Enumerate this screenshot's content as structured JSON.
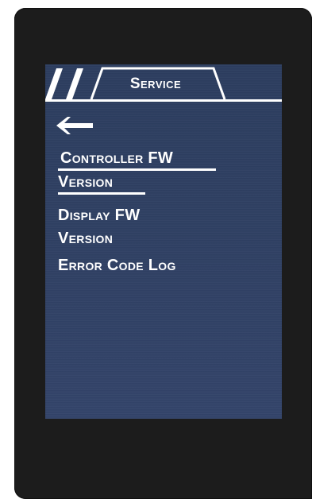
{
  "header": {
    "title": "Service"
  },
  "icons": {
    "back": "arrow-left-icon"
  },
  "menu": {
    "items": [
      {
        "line1": "Controller FW",
        "line2": "Version",
        "selected": true
      },
      {
        "line1": "Display FW",
        "line2": "Version",
        "selected": false
      },
      {
        "line1": "Error Code Log",
        "selected": false
      }
    ]
  },
  "colors": {
    "bezel": "#1c1c1c",
    "screen": "#2f4063",
    "text": "#ffffff"
  }
}
